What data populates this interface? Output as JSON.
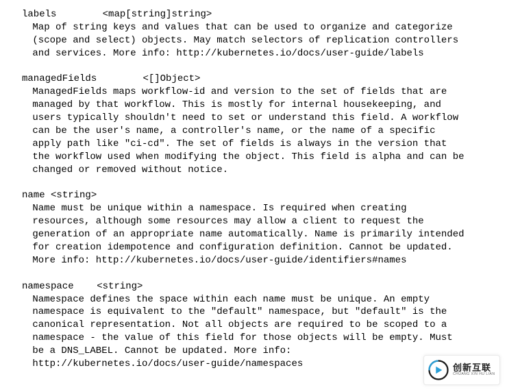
{
  "fields": [
    {
      "name": "labels",
      "spacer": "        ",
      "type": "<map[string]string>",
      "description": "Map of string keys and values that can be used to organize and categorize\n(scope and select) objects. May match selectors of replication controllers\nand services. More info: http://kubernetes.io/docs/user-guide/labels"
    },
    {
      "name": "managedFields",
      "spacer": "        ",
      "type": "<[]Object>",
      "description": "ManagedFields maps workflow-id and version to the set of fields that are\nmanaged by that workflow. This is mostly for internal housekeeping, and\nusers typically shouldn't need to set or understand this field. A workflow\ncan be the user's name, a controller's name, or the name of a specific\napply path like \"ci-cd\". The set of fields is always in the version that\nthe workflow used when modifying the object. This field is alpha and can be\nchanged or removed without notice."
    },
    {
      "name": "name",
      "spacer": " ",
      "type": "<string>",
      "description": "Name must be unique within a namespace. Is required when creating\nresources, although some resources may allow a client to request the\ngeneration of an appropriate name automatically. Name is primarily intended\nfor creation idempotence and configuration definition. Cannot be updated.\nMore info: http://kubernetes.io/docs/user-guide/identifiers#names"
    },
    {
      "name": "namespace",
      "spacer": "    ",
      "type": "<string>",
      "description": "Namespace defines the space within each name must be unique. An empty\nnamespace is equivalent to the \"default\" namespace, but \"default\" is the\ncanonical representation. Not all objects are required to be scoped to a\nnamespace - the value of this field for those objects will be empty. Must\nbe a DNS_LABEL. Cannot be updated. More info:\nhttp://kubernetes.io/docs/user-guide/namespaces"
    }
  ],
  "watermark": {
    "main": "创新互联",
    "sub": "CHUANG XIN HU LIAN"
  }
}
